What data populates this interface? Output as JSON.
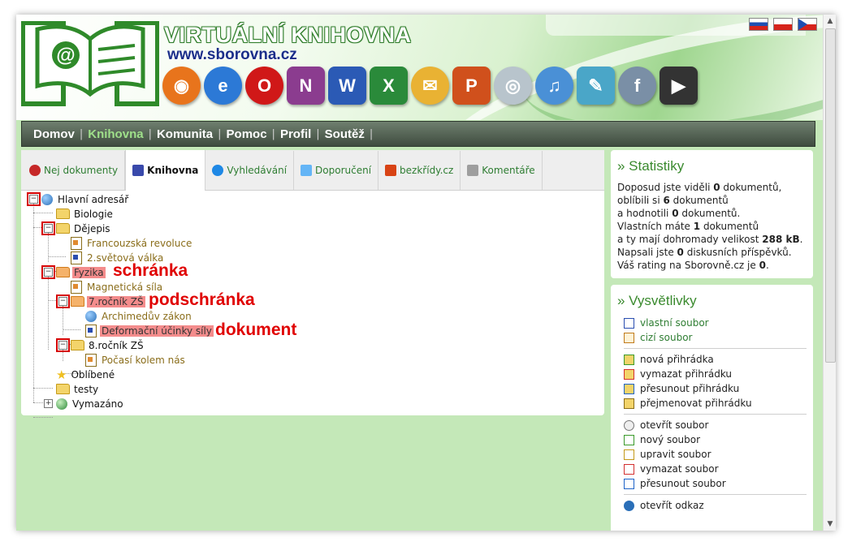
{
  "header": {
    "title": "VIRTUÁLNÍ KNIHOVNA",
    "url": "www.sborovna.cz",
    "app_icons": [
      {
        "name": "firefox-icon",
        "color": "#e8741c"
      },
      {
        "name": "ie-icon",
        "color": "#2c79d6"
      },
      {
        "name": "opera-icon",
        "color": "#d01818"
      },
      {
        "name": "onenote-icon",
        "color": "#8b3c8f"
      },
      {
        "name": "word-icon",
        "color": "#2b5ab5"
      },
      {
        "name": "excel-icon",
        "color": "#2a8a3a"
      },
      {
        "name": "outlook-icon",
        "color": "#e9b233"
      },
      {
        "name": "powerpoint-icon",
        "color": "#d0501c"
      },
      {
        "name": "cd-icon",
        "color": "#b8c4cc"
      },
      {
        "name": "itunes-icon",
        "color": "#4a90d6"
      },
      {
        "name": "feather-icon",
        "color": "#4aa6c8"
      },
      {
        "name": "flash-icon",
        "color": "#7a8fa6"
      },
      {
        "name": "avi-video-icon",
        "color": "#333333"
      }
    ],
    "flags": [
      "sk",
      "pl",
      "cz"
    ]
  },
  "nav": {
    "items": [
      {
        "label": "Domov",
        "active": false
      },
      {
        "label": "Knihovna",
        "active": true
      },
      {
        "label": "Komunita",
        "active": false
      },
      {
        "label": "Pomoc",
        "active": false
      },
      {
        "label": "Profil",
        "active": false
      },
      {
        "label": "Soutěž",
        "active": false
      }
    ],
    "separator": "|"
  },
  "tabs": [
    {
      "label": "Nej dokumenty",
      "icon": "medal-icon",
      "active": false
    },
    {
      "label": "Knihovna",
      "icon": "book-icon",
      "active": true
    },
    {
      "label": "Vyhledávání",
      "icon": "magnifier-icon",
      "active": false
    },
    {
      "label": "Doporučení",
      "icon": "envelope-icon",
      "active": false
    },
    {
      "label": "bezkřídy.cz",
      "icon": "house-icon",
      "active": false
    },
    {
      "label": "Komentáře",
      "icon": "speech-bubble-icon",
      "active": false
    }
  ],
  "tree": {
    "root": "Hlavní adresář",
    "biologie": "Biologie",
    "dejepis": "Dějepis",
    "francouzska": "Francouzská revoluce",
    "valka": "2.světová válka",
    "fyzika": "Fyzika",
    "magneticka": "Magnetická síla",
    "rocnik7": "7.ročník ZŠ",
    "archimeduv": "Archimedův zákon",
    "deformacni": "Deformační účinky síly",
    "rocnik8": "8.ročník ZŠ",
    "pocasi": "Počasí kolem nás",
    "oblibene": "Oblíbené",
    "testy": "testy",
    "vymazano": "Vymazáno"
  },
  "annotations": {
    "schranka": "schránka",
    "podschranka": "podschránka",
    "dokument": "dokument"
  },
  "stats": {
    "title": "» Statistiky",
    "lines": [
      [
        "Doposud jste viděli ",
        "0",
        " dokumentů,"
      ],
      [
        "oblíbili si ",
        "6",
        " dokumentů"
      ],
      [
        "a hodnotili ",
        "0",
        " dokumentů."
      ],
      [
        "Vlastních máte ",
        "1",
        " dokumentů"
      ],
      [
        "a ty mají dohromady velikost ",
        "288 kB",
        "."
      ],
      [
        "Napsali jste ",
        "0",
        " diskusních příspěvků."
      ],
      [
        "Váš rating na Sborovně.cz je ",
        "0",
        "."
      ]
    ]
  },
  "legend": {
    "title": "» Vysvětlivky",
    "groups": [
      [
        {
          "label": "vlastní soubor",
          "icon": "own-file-icon",
          "link": true
        },
        {
          "label": "cizí soubor",
          "icon": "foreign-file-icon",
          "link": true
        }
      ],
      [
        {
          "label": "nová přihrádka",
          "icon": "new-folder-icon",
          "link": false
        },
        {
          "label": "vymazat přihrádku",
          "icon": "delete-folder-icon",
          "link": false
        },
        {
          "label": "přesunout přihrádku",
          "icon": "move-folder-icon",
          "link": false
        },
        {
          "label": "přejmenovat přihrádku",
          "icon": "rename-folder-icon",
          "link": false
        }
      ],
      [
        {
          "label": "otevřít soubor",
          "icon": "open-file-icon",
          "link": false
        },
        {
          "label": "nový soubor",
          "icon": "new-file-icon",
          "link": false
        },
        {
          "label": "upravit soubor",
          "icon": "edit-file-icon",
          "link": false
        },
        {
          "label": "vymazat soubor",
          "icon": "delete-file-icon",
          "link": false
        },
        {
          "label": "přesunout soubor",
          "icon": "move-file-icon",
          "link": false
        }
      ],
      [
        {
          "label": "otevřít odkaz",
          "icon": "open-link-icon",
          "link": false
        }
      ]
    ]
  }
}
